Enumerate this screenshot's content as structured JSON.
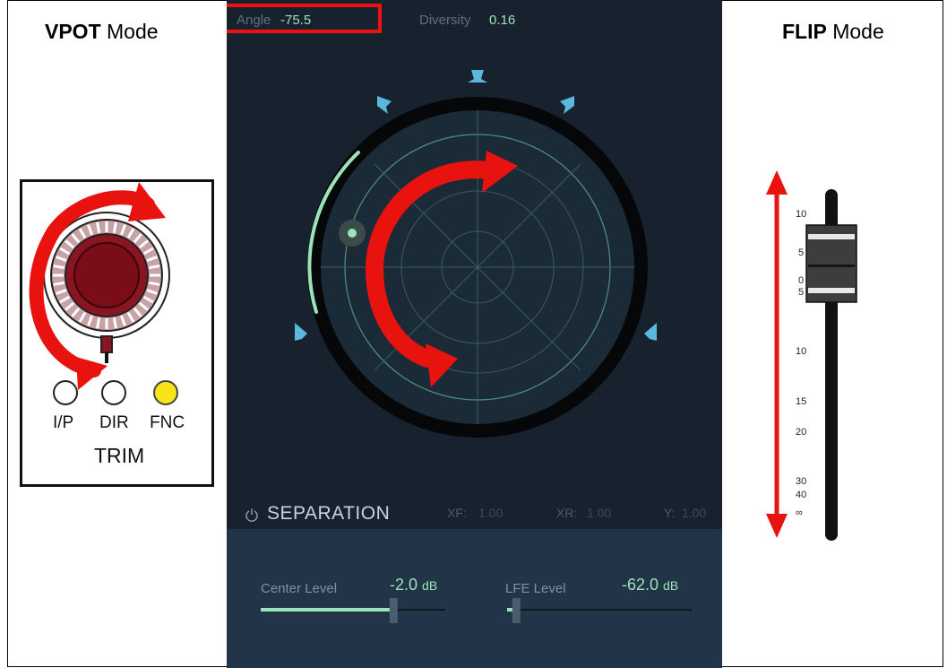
{
  "vpot": {
    "title_bold": "VPOT",
    "title_rest": " Mode",
    "leds": [
      {
        "label": "I/P",
        "state": "off"
      },
      {
        "label": "DIR",
        "state": "off"
      },
      {
        "label": "FNC",
        "state": "on"
      }
    ],
    "trim_label": "TRIM"
  },
  "flip": {
    "title_bold": "FLIP",
    "title_rest": " Mode",
    "scale": [
      "10",
      "5",
      "0",
      "5",
      "10",
      "15",
      "20",
      "30",
      "40",
      "∞"
    ]
  },
  "plugin": {
    "angle_label": "Angle",
    "angle_value": "-75.5",
    "diversity_label": "Diversity",
    "diversity_value": "0.16",
    "separation_title": "SEPARATION",
    "xf_label": "XF:",
    "xf_value": "1.00",
    "xr_label": "XR:",
    "xr_value": "1.00",
    "y_label": "Y:",
    "y_value": "1.00",
    "center_level_label": "Center Level",
    "center_level_value": "-2.0",
    "center_level_unit": "dB",
    "center_level_fraction": 0.72,
    "lfe_level_label": "LFE Level",
    "lfe_level_value": "-62.0",
    "lfe_level_unit": "dB",
    "lfe_level_fraction": 0.05
  },
  "colors": {
    "accent_green": "#9be3b9",
    "arrow_red": "#e8120f",
    "speaker_blue": "#5ab8dc",
    "led_yellow": "#f7e51a"
  }
}
